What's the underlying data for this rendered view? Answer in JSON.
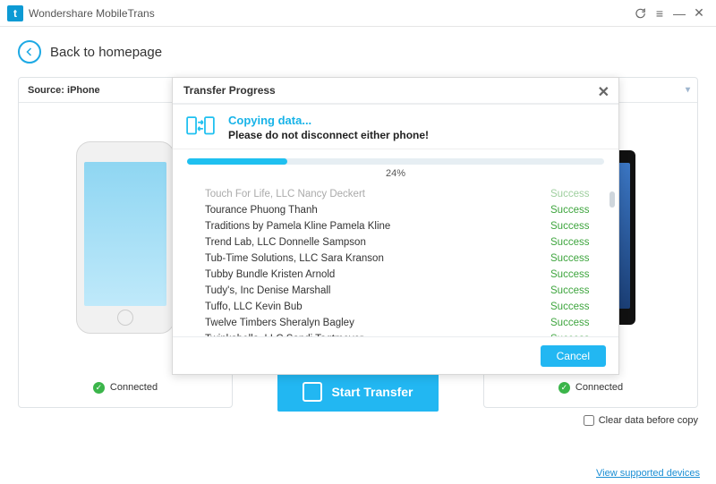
{
  "app": {
    "logo_letter": "t",
    "title": "Wondershare MobileTrans"
  },
  "back": {
    "label": "Back to homepage"
  },
  "source_panel": {
    "label": "Source: iPhone",
    "status": "Connected"
  },
  "dest_panel": {
    "label": "",
    "status": "Connected"
  },
  "start_button": "Start Transfer",
  "clear_checkbox": "Clear data before copy",
  "footer_link": "View supported devices",
  "dialog": {
    "title": "Transfer Progress",
    "copy_title": "Copying data...",
    "copy_sub": "Please do not disconnect either phone!",
    "percent": 24,
    "percent_label": "24%",
    "cancel": "Cancel",
    "success_label": "Success",
    "items": [
      {
        "name": "Touch For Life, LLC Nancy Deckert",
        "status": "Success",
        "faded": true
      },
      {
        "name": "Tourance Phuong Thanh",
        "status": "Success"
      },
      {
        "name": "Traditions by Pamela Kline Pamela Kline",
        "status": "Success"
      },
      {
        "name": "Trend Lab, LLC Donnelle Sampson",
        "status": "Success"
      },
      {
        "name": "Tub-Time Solutions, LLC Sara Kranson",
        "status": "Success"
      },
      {
        "name": "Tubby Bundle Kristen Arnold",
        "status": "Success"
      },
      {
        "name": "Tudy's, Inc Denise Marshall",
        "status": "Success"
      },
      {
        "name": "Tuffo, LLC Kevin Bub",
        "status": "Success"
      },
      {
        "name": "Twelve Timbers Sheralyn Bagley",
        "status": "Success"
      },
      {
        "name": "Twinkabella, LLC Sandi Tagtmeyer",
        "status": "Success"
      }
    ]
  }
}
